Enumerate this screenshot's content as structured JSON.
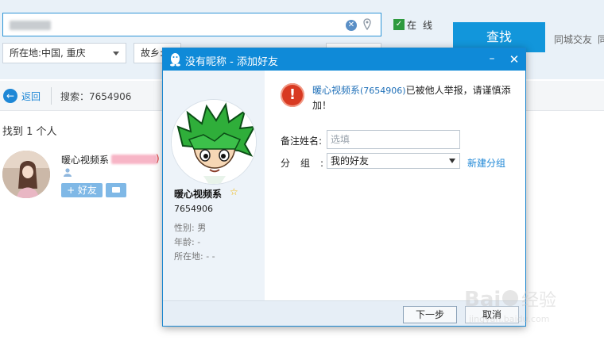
{
  "search": {
    "query_obscured": true,
    "online_label": "在线",
    "find_label": "查找",
    "same_city_label": "同城交友",
    "same_city_tail": "同"
  },
  "filters": {
    "location_label": "所在地:中国, 重庆",
    "hometown_label": "故乡:"
  },
  "nav": {
    "back_label": "返回",
    "search_term": "搜索：7654906"
  },
  "results": {
    "count_text": "找到 1 个人",
    "items": [
      {
        "name": "暖心视频系",
        "name_suffix": ")",
        "add_label": "+ 好友"
      }
    ]
  },
  "dialog": {
    "title": "没有昵称 - 添加好友",
    "minimize_glyph": "–",
    "close_glyph": "✕",
    "profile": {
      "name": "暖心视频系",
      "qq_number": "7654906",
      "gender": "性别: 男",
      "age": "年龄: -",
      "location": "所在地: -  -"
    },
    "warning": {
      "name": "暖心视频系",
      "number": "(7654906)",
      "message": "已被他人举报，请谨慎添加！"
    },
    "remark_label": "备注姓名:",
    "remark_placeholder": "选填",
    "group_label": "分组:",
    "group_value": "我的好友",
    "new_group_label": "新建分组",
    "next_label": "下一步",
    "cancel_label": "取消"
  },
  "watermark": {
    "text": "Baidu经验",
    "url_text": "jingyan.baidu.com"
  },
  "colors": {
    "accent": "#0f8ad8",
    "warning": "#d83a22",
    "link": "#1e87d6"
  }
}
